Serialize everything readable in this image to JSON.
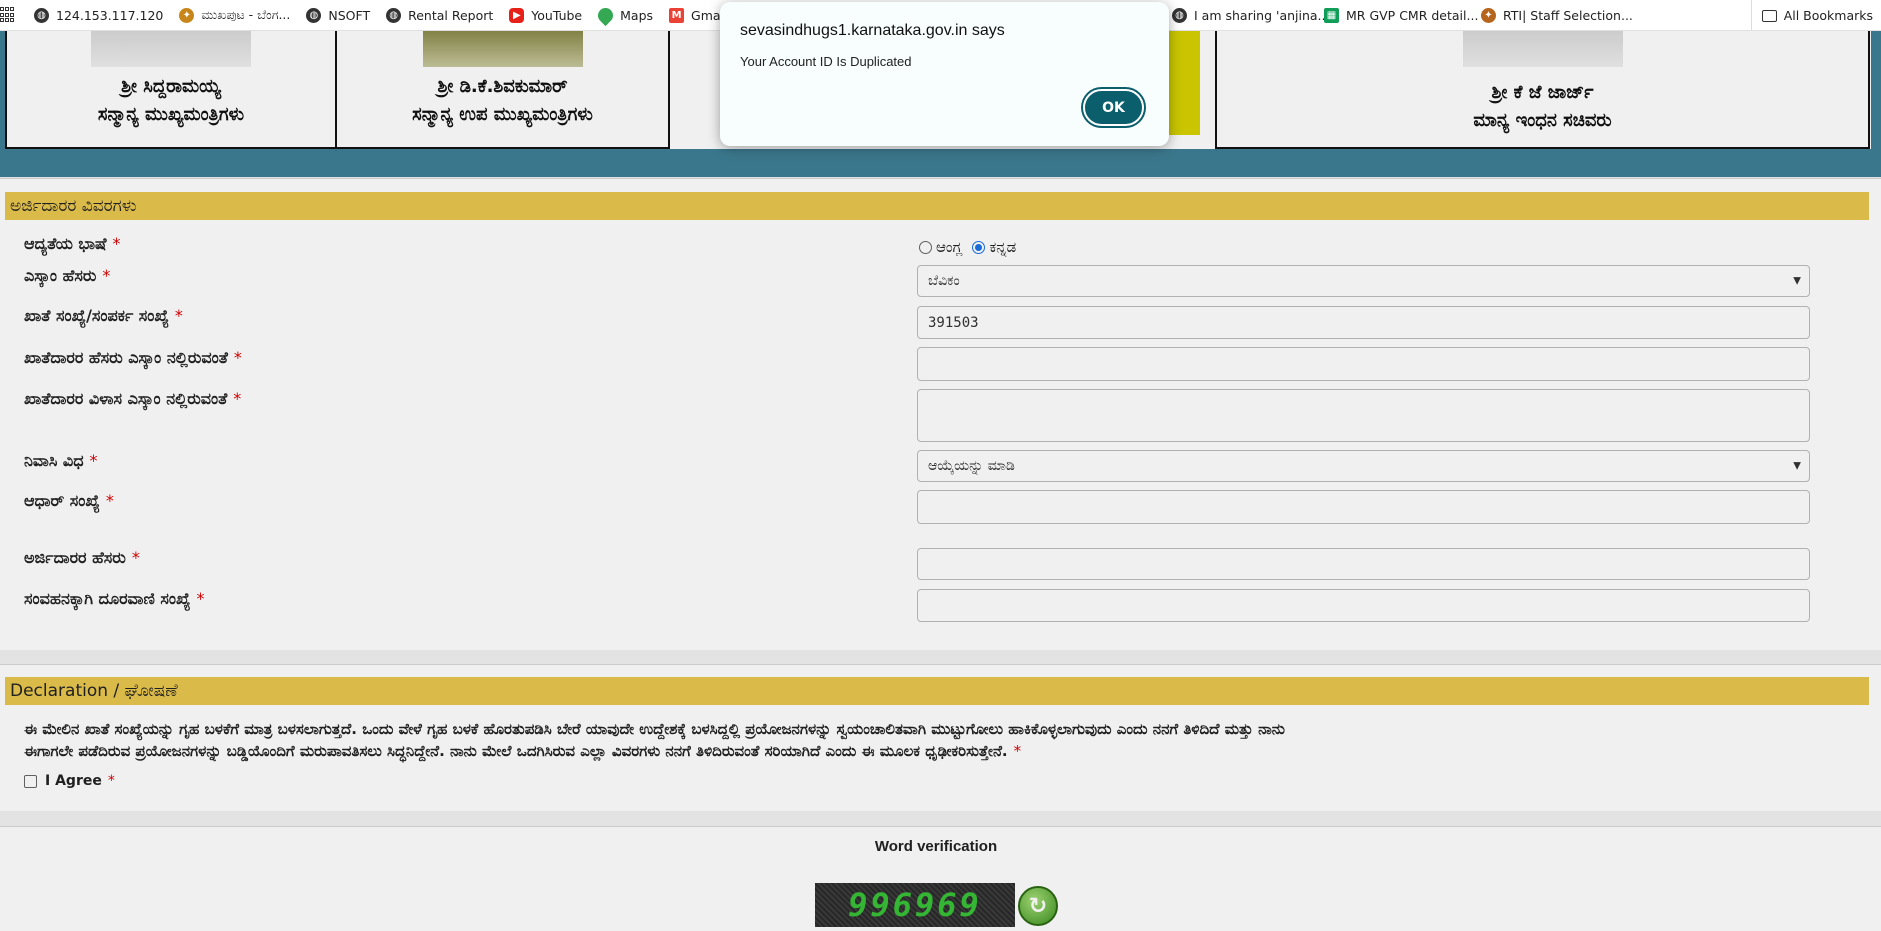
{
  "bookmarks": {
    "items": [
      {
        "label": "124.153.117.120",
        "icon": "globe-icon",
        "color": "#333333"
      },
      {
        "label": "ಮುಖಪುಟ - ಬೆಂಗ...",
        "icon": "emblem-icon",
        "color": "#c8861a"
      },
      {
        "label": "NSOFT",
        "icon": "globe-icon",
        "color": "#333333"
      },
      {
        "label": "Rental Report",
        "icon": "globe-icon",
        "color": "#333333"
      },
      {
        "label": "YouTube",
        "icon": "youtube-icon",
        "color": "#e62117"
      },
      {
        "label": "Maps",
        "icon": "maps-icon",
        "color": "#34a853"
      },
      {
        "label": "Gmail",
        "icon": "gmail-icon",
        "color": "#ea4335"
      }
    ],
    "items_right": [
      {
        "label": "I am sharing 'anjina...",
        "icon": "globe-icon",
        "color": "#333333"
      },
      {
        "label": "MR GVP CMR detail...",
        "icon": "sheets-icon",
        "color": "#0f9d58"
      },
      {
        "label": "RTI| Staff Selection...",
        "icon": "emblem-icon",
        "color": "#b5651d"
      }
    ],
    "all_bookmarks": "All Bookmarks"
  },
  "leaders": [
    {
      "name": "ಶ್ರೀ ಸಿದ್ದರಾಮಯ್ಯ",
      "role": "ಸನ್ಮಾನ್ಯ ಮುಖ್ಯಮಂತ್ರಿಗಳು"
    },
    {
      "name": "ಶ್ರೀ ಡಿ.ಕೆ.ಶಿವಕುಮಾರ್",
      "role": "ಸನ್ಮಾನ್ಯ ಉಪ ಮುಖ್ಯಮಂತ್ರಿಗಳು"
    },
    {
      "name": "ಶ್ರೀ ಕೆ ಜೆ ಜಾರ್ಜ್",
      "role": "ಮಾನ್ಯ ಇಂಧನ ಸಚಿವರು"
    }
  ],
  "applicant": {
    "section_title": "ಅರ್ಜಿದಾರರ ವಿವರಗಳು",
    "fields": {
      "language_label": "ಆದ್ಯತೆಯ ಭಾಷೆ",
      "language_options": [
        "ಆಂಗ್ಲ",
        "ಕನ್ನಡ"
      ],
      "language_selected": "ಕನ್ನಡ",
      "escom_label": "ಎಸ್ಕಾಂ ಹೆಸರು",
      "escom_value": "ಬೆವಿಕಂ",
      "account_label": "ಖಾತೆ ಸಂಖ್ಯೆ/ಸಂಪರ್ಕ ಸಂಖ್ಯೆ",
      "account_value": "391503",
      "holder_name_label": "ಖಾತೆದಾರರ ಹೆಸರು ಎಸ್ಕಾಂ ನಲ್ಲಿರುವಂತೆ",
      "holder_name_value": "",
      "holder_address_label": "ಖಾತೆದಾರರ ವಿಳಾಸ ಎಸ್ಕಾಂ ನಲ್ಲಿರುವಂತೆ",
      "holder_address_value": "",
      "residence_label": "ನಿವಾಸಿ ವಿಧ",
      "residence_value": "ಆಯ್ಕೆಯನ್ನು ಮಾಡಿ",
      "aadhaar_label": "ಆಧಾರ್ ಸಂಖ್ಯೆ",
      "aadhaar_value": "",
      "applicant_name_label": "ಅರ್ಜಿದಾರರ ಹೆಸರು",
      "applicant_name_value": "",
      "phone_label": "ಸಂವಹನಕ್ಕಾಗಿ ದೂರವಾಣಿ ಸಂಖ್ಯೆ",
      "phone_value": ""
    },
    "required_mark": "*"
  },
  "declaration": {
    "section_title": "Declaration / ಘೋಷಣೆ",
    "text_line1": "ಈ ಮೇಲಿನ ಖಾತೆ ಸಂಖ್ಯೆಯನ್ನು ಗೃಹ ಬಳಕೆಗೆ ಮಾತ್ರ ಬಳಸಲಾಗುತ್ತದೆ. ಒಂದು ವೇಳೆ ಗೃಹ ಬಳಕೆ ಹೊರತುಪಡಿಸಿ ಬೇರೆ ಯಾವುದೇ ಉದ್ದೇಶಕ್ಕೆ ಬಳಸಿದ್ದಲ್ಲಿ ಪ್ರಯೋಜನಗಳನ್ನು ಸ್ವಯಂಚಾಲಿತವಾಗಿ ಮುಟ್ಟುಗೋಲು ಹಾಕಿಕೊಳ್ಳಲಾಗುವುದು ಎಂದು ನನಗೆ ತಿಳಿದಿದೆ ಮತ್ತು ನಾನು",
    "text_line2": "ಈಗಾಗಲೇ ಪಡೆದಿರುವ ಪ್ರಯೋಜನಗಳನ್ನು ಬಡ್ಡಿಯೊಂದಿಗೆ ಮರುಪಾವತಿಸಲು ಸಿದ್ಧನಿದ್ದೇನೆ. ನಾನು ಮೇಲೆ ಒದಗಿಸಿರುವ ಎಲ್ಲಾ ವಿವರಗಳು ನನಗೆ ತಿಳಿದಿರುವಂತೆ ಸರಿಯಾಗಿದೆ ಎಂದು ಈ ಮೂಲಕ ಧೃಢೀಕರಿಸುತ್ತೇನೆ.",
    "agree_label": "I Agree"
  },
  "verification": {
    "title": "Word verification",
    "captcha_text": "996969"
  },
  "dialog": {
    "title": "sevasindhugs1.karnataka.gov.in says",
    "message": "Your Account ID Is Duplicated",
    "ok_label": "OK"
  }
}
